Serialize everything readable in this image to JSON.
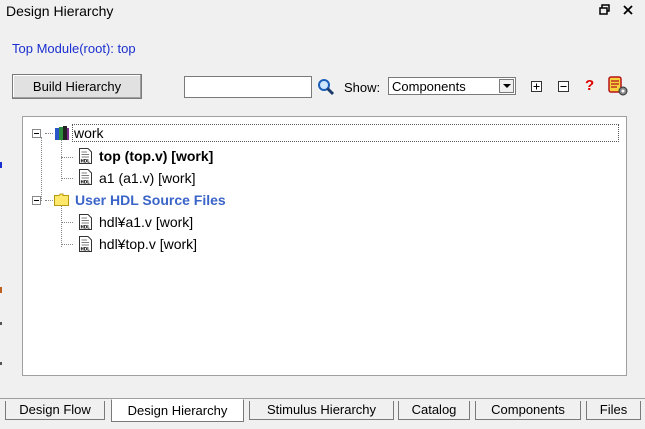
{
  "window": {
    "title": "Design Hierarchy"
  },
  "top_module": "Top Module(root): top",
  "toolbar": {
    "build_label": "Build Hierarchy",
    "search_value": "",
    "show_label": "Show:",
    "show_value": "Components",
    "help_label": "?"
  },
  "tree": {
    "work": "work",
    "top": "top (top.v) [work]",
    "a1": "a1 (a1.v) [work]",
    "user_hdl": "User HDL Source Files",
    "hdl_a1": "hdl¥a1.v [work]",
    "hdl_top": "hdl¥top.v [work]"
  },
  "tabs": [
    "Design Flow",
    "Design Hierarchy",
    "Stimulus Hierarchy",
    "Catalog",
    "Components",
    "Files"
  ],
  "colors": {
    "link_blue": "#1a2fd0",
    "folder_label_blue": "#3a64c8"
  }
}
